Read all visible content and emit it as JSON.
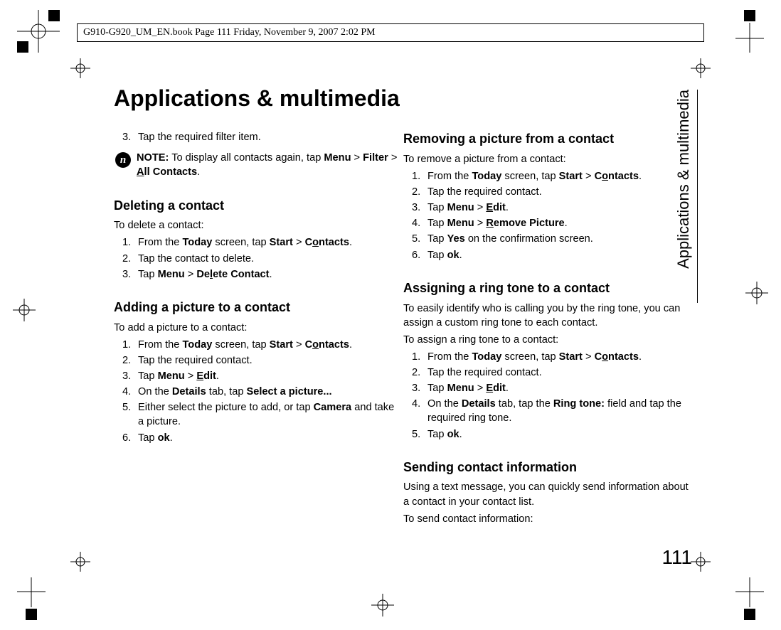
{
  "bookline": "G910-G920_UM_EN.book  Page 111  Friday, November 9, 2007  2:02 PM",
  "title": "Applications & multimedia",
  "sideLabel": "Applications & multimedia",
  "pageNumber": "111",
  "left": {
    "step3": "Tap the required filter item.",
    "noteLabel": "NOTE:",
    "noteA": " To display all contacts again, tap ",
    "noteMenu": "Menu",
    "noteGt1": " > ",
    "noteFilter": "Filter",
    "noteGt2": " > ",
    "noteAll_pre": "A",
    "noteAll_rest": "ll Contacts",
    "noteDot": ".",
    "delHead": "Deleting a contact",
    "delLead": "To delete a contact:",
    "del1a": "From the ",
    "del1Today": "Today",
    "del1b": " screen, tap ",
    "del1Start": "Start",
    "del1c": " > ",
    "del1Co_pre": "C",
    "del1Co_u": "o",
    "del1Co_rest": "ntacts",
    "del1d": ".",
    "del2": "Tap the contact to delete.",
    "del3a": "Tap ",
    "del3Menu": "Menu",
    "del3b": " > ",
    "del3De_pre": "De",
    "del3De_u": "l",
    "del3De_rest": "ete Contact",
    "del3c": ".",
    "addHead": "Adding a picture to a contact",
    "addLead": "To add a picture to a contact:",
    "add1a": "From the ",
    "add1Today": "Today",
    "add1b": " screen, tap ",
    "add1Start": "Start",
    "add1c": " > ",
    "add1Co_pre": "C",
    "add1Co_u": "o",
    "add1Co_rest": "ntacts",
    "add1d": ".",
    "add2": "Tap the required contact.",
    "add3a": "Tap ",
    "add3Menu": "Menu",
    "add3b": " > ",
    "add3E_u": "E",
    "add3E_rest": "dit",
    "add3c": ".",
    "add4a": "On the ",
    "add4Details": "Details",
    "add4b": " tab, tap ",
    "add4Sel": "Select a picture...",
    "add5a": "Either select the picture to add, or tap ",
    "add5Cam": "Camera",
    "add5b": " and take a picture.",
    "add6a": "Tap ",
    "add6ok": "ok",
    "add6b": "."
  },
  "right": {
    "remHead": "Removing a picture from a contact",
    "remLead": "To remove a picture from a contact:",
    "rem1a": "From the ",
    "rem1Today": "Today",
    "rem1b": " screen, tap ",
    "rem1Start": "Start",
    "rem1c": " > ",
    "rem1Co_pre": "C",
    "rem1Co_u": "o",
    "rem1Co_rest": "ntacts",
    "rem1d": ".",
    "rem2": "Tap the required contact.",
    "rem3a": "Tap ",
    "rem3Menu": "Menu",
    "rem3b": " > ",
    "rem3E_u": "E",
    "rem3E_rest": "dit",
    "rem3c": ".",
    "rem4a": "Tap ",
    "rem4Menu": "Menu",
    "rem4b": " > ",
    "rem4R_u": "R",
    "rem4R_rest": "emove Picture",
    "rem4c": ".",
    "rem5a": "Tap ",
    "rem5Yes": "Yes",
    "rem5b": " on the confirmation screen.",
    "rem6a": "Tap ",
    "rem6ok": "ok",
    "rem6b": ".",
    "ringHead": "Assigning a ring tone to a contact",
    "ringPara": "To easily identify who is calling you by the ring tone, you can assign a custom ring tone to each contact.",
    "ringLead": "To assign a ring tone to a contact:",
    "ring1a": "From the ",
    "ring1Today": "Today",
    "ring1b": " screen, tap ",
    "ring1Start": "Start",
    "ring1c": " > ",
    "ring1Co_pre": "C",
    "ring1Co_u": "o",
    "ring1Co_rest": "ntacts",
    "ring1d": ".",
    "ring2": "Tap the required contact.",
    "ring3a": "Tap ",
    "ring3Menu": "Menu",
    "ring3b": " > ",
    "ring3E_u": "E",
    "ring3E_rest": "dit",
    "ring3c": ".",
    "ring4a": "On the ",
    "ring4Details": "Details",
    "ring4b": " tab, tap the ",
    "ring4Ring": "Ring tone:",
    "ring4c": " field and tap the required ring tone.",
    "ring5a": "Tap ",
    "ring5ok": "ok",
    "ring5b": ".",
    "sendHead": "Sending contact information",
    "sendPara": "Using a text message, you can quickly send information about a contact in your contact list.",
    "sendLead": "To send contact information:"
  }
}
